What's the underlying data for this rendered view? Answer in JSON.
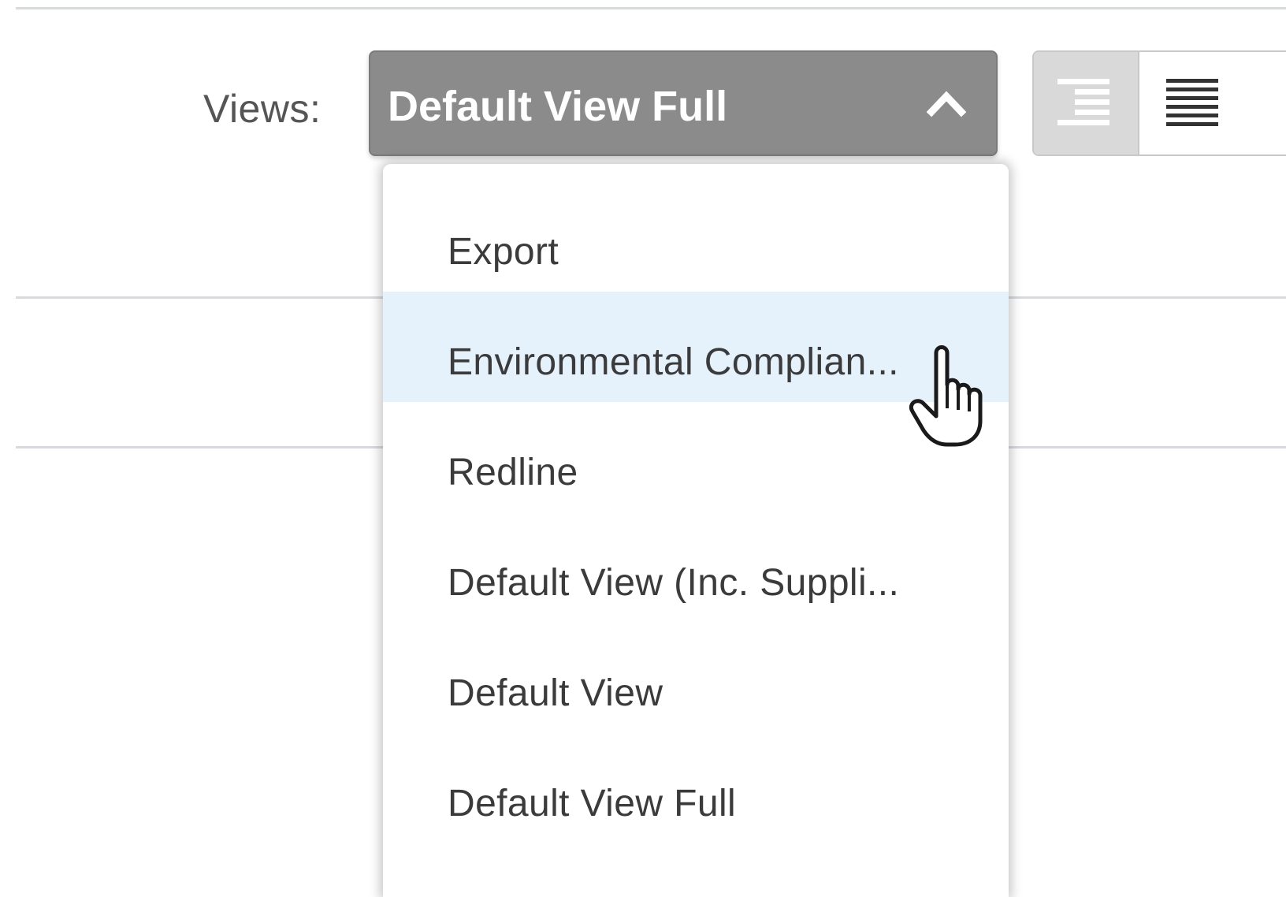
{
  "views": {
    "label": "Views:",
    "selected": "Default View Full",
    "options": [
      "Export",
      "Environmental Complian...",
      "Redline",
      "Default View (Inc. Suppli...",
      "Default View",
      "Default View Full"
    ],
    "hovered_index": 1
  },
  "layout_toggle": {
    "active": "indented"
  },
  "colors": {
    "select_bg": "#8b8b8b",
    "hover_bg": "#e5f2fc",
    "separator": "#d7dbe0"
  },
  "icons": {
    "chevron": "chevron-up-icon",
    "indented_list": "indented-list-icon",
    "flat_list": "flat-list-icon",
    "cursor": "hand-pointer-cursor-icon"
  }
}
